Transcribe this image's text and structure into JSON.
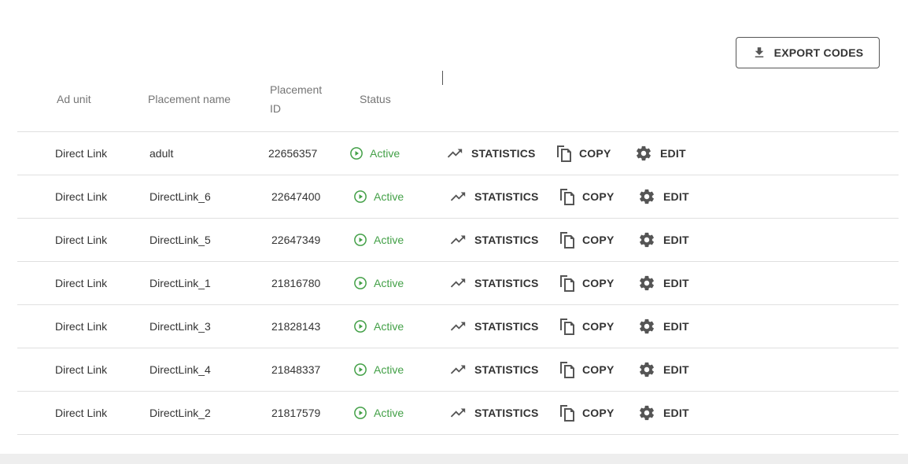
{
  "toolbar": {
    "export_label": "EXPORT CODES"
  },
  "table": {
    "headers": {
      "ad_unit": "Ad unit",
      "placement_name": "Placement name",
      "placement_id_line1": "Placement",
      "placement_id_line2": "ID",
      "status": "Status"
    },
    "actions": {
      "statistics": "STATISTICS",
      "copy": "COPY",
      "edit": "EDIT"
    },
    "status_color": "#43a047",
    "rows": [
      {
        "ad_unit": "Direct Link",
        "placement_name": "adult",
        "placement_id": "22656357",
        "status": "Active"
      },
      {
        "ad_unit": "Direct Link",
        "placement_name": "DirectLink_6",
        "placement_id": "22647400",
        "status": "Active"
      },
      {
        "ad_unit": "Direct Link",
        "placement_name": "DirectLink_5",
        "placement_id": "22647349",
        "status": "Active"
      },
      {
        "ad_unit": "Direct Link",
        "placement_name": "DirectLink_1",
        "placement_id": "21816780",
        "status": "Active"
      },
      {
        "ad_unit": "Direct Link",
        "placement_name": "DirectLink_3",
        "placement_id": "21828143",
        "status": "Active"
      },
      {
        "ad_unit": "Direct Link",
        "placement_name": "DirectLink_4",
        "placement_id": "21848337",
        "status": "Active"
      },
      {
        "ad_unit": "Direct Link",
        "placement_name": "DirectLink_2",
        "placement_id": "21817579",
        "status": "Active"
      }
    ]
  },
  "icons": {
    "export": "download-icon",
    "status": "play-circle-icon",
    "statistics": "trending-up-icon",
    "copy": "copy-icon",
    "edit": "gear-icon"
  }
}
